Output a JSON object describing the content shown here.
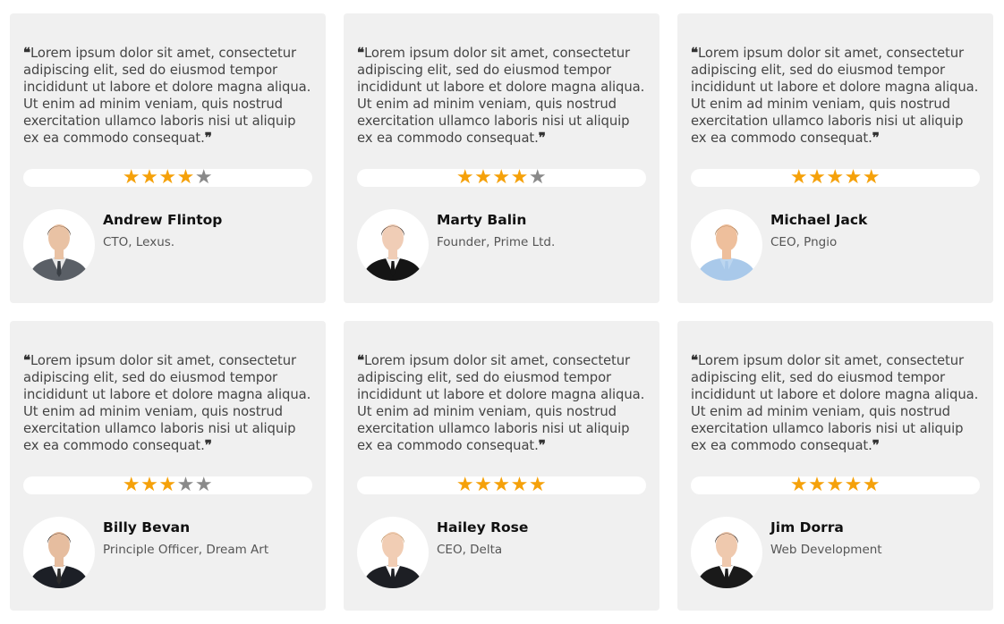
{
  "testimonials": [
    {
      "quote": "Lorem ipsum dolor sit amet, consectetur adipiscing elit, sed do eiusmod tempor incididunt ut labore et dolore magna aliqua. Ut enim ad minim veniam, quis nostrud exercitation ullamco laboris nisi ut aliquip ex ea commodo consequat.",
      "rating": 4,
      "max_rating": 5,
      "name": "Andrew Flintop",
      "role": "CTO, Lexus.",
      "avatar": {
        "suit": "#5a5f66",
        "shirt": "#e8e8e8",
        "tie": "#3a3f45",
        "hair": "#4a3526",
        "skin": "#e9c2a4"
      }
    },
    {
      "quote": "Lorem ipsum dolor sit amet, consectetur adipiscing elit, sed do eiusmod tempor incididunt ut labore et dolore magna aliqua. Ut enim ad minim veniam, quis nostrud exercitation ullamco laboris nisi ut aliquip ex ea commodo consequat.",
      "rating": 4,
      "max_rating": 5,
      "name": "Marty Balin",
      "role": "Founder, Prime Ltd.",
      "avatar": {
        "suit": "#151515",
        "shirt": "#f4f4f4",
        "tie": "#151515",
        "hair": "#2b1c14",
        "skin": "#f0cdb6"
      }
    },
    {
      "quote": "Lorem ipsum dolor sit amet, consectetur adipiscing elit, sed do eiusmod tempor incididunt ut labore et dolore magna aliqua. Ut enim ad minim veniam, quis nostrud exercitation ullamco laboris nisi ut aliquip ex ea commodo consequat.",
      "rating": 5,
      "max_rating": 5,
      "name": "Michael Jack",
      "role": "CEO, Pngio",
      "avatar": {
        "suit": "#a9c9ea",
        "shirt": "#bcd6f0",
        "tie": "#a9c9ea",
        "hair": "#9a6a3e",
        "skin": "#eebf9c"
      }
    },
    {
      "quote": "Lorem ipsum dolor sit amet, consectetur adipiscing elit, sed do eiusmod tempor incididunt ut labore et dolore magna aliqua. Ut enim ad minim veniam, quis nostrud exercitation ullamco laboris nisi ut aliquip ex ea commodo consequat.",
      "rating": 3,
      "max_rating": 5,
      "name": "Billy Bevan",
      "role": "Principle Officer, Dream Art",
      "avatar": {
        "suit": "#1c1f26",
        "shirt": "#f4f4f4",
        "tie": "#2a2a2a",
        "hair": "#1e1510",
        "skin": "#e6bd9f"
      }
    },
    {
      "quote": "Lorem ipsum dolor sit amet, consectetur adipiscing elit, sed do eiusmod tempor incididunt ut labore et dolore magna aliqua. Ut enim ad minim veniam, quis nostrud exercitation ullamco laboris nisi ut aliquip ex ea commodo consequat.",
      "rating": 5,
      "max_rating": 5,
      "name": "Hailey Rose",
      "role": "CEO, Delta",
      "avatar": {
        "suit": "#1d1f24",
        "shirt": "#ffffff",
        "tie": "#1d1f24",
        "hair": "#b88a55",
        "skin": "#f1cdb4"
      }
    },
    {
      "quote": "Lorem ipsum dolor sit amet, consectetur adipiscing elit, sed do eiusmod tempor incididunt ut labore et dolore magna aliqua. Ut enim ad minim veniam, quis nostrud exercitation ullamco laboris nisi ut aliquip ex ea commodo consequat.",
      "rating": 5,
      "max_rating": 5,
      "name": "Jim Dorra",
      "role": "Web Development",
      "avatar": {
        "suit": "#1a1a1a",
        "shirt": "#ffffff",
        "tie": "#1a1a1a",
        "hair": "#241611",
        "skin": "#efc9ae"
      }
    }
  ],
  "colors": {
    "card_bg": "#f0f0f0",
    "star_on": "#f5a10a",
    "star_off": "#8a8a8a"
  },
  "icons": {
    "open_quote": "format-quote-open-icon",
    "close_quote": "format-quote-close-icon",
    "star": "star-icon"
  }
}
